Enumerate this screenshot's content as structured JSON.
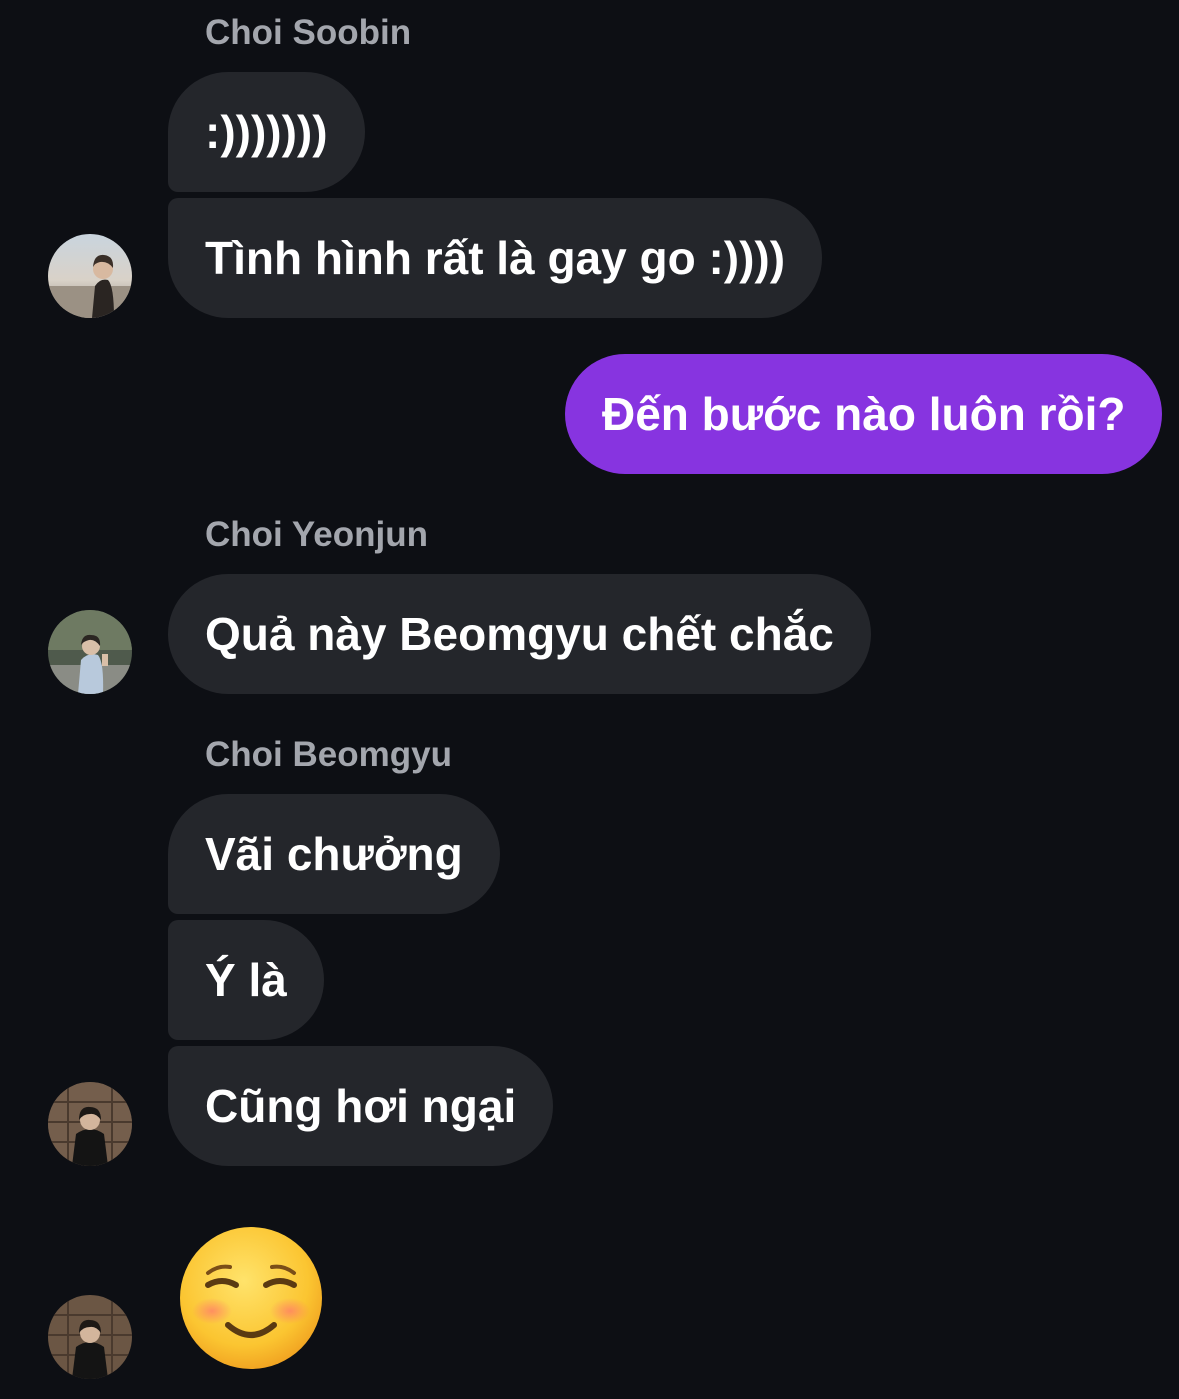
{
  "conversation": {
    "groups": [
      {
        "sender": "Choi Soobin",
        "avatar_icon": "avatar-soobin",
        "messages": [
          ":)))))))",
          "Tình hình rất là gay go :))))"
        ]
      },
      {
        "sender": "",
        "outgoing": true,
        "messages": [
          "Đến bước nào luôn rồi?"
        ]
      },
      {
        "sender": "Choi Yeonjun",
        "avatar_icon": "avatar-yeonjun",
        "messages": [
          "Quả này Beomgyu chết chắc"
        ]
      },
      {
        "sender": "Choi Beomgyu",
        "avatar_icon": "avatar-beomgyu",
        "messages": [
          "Vãi chưởng",
          "Ý là",
          "Cũng hơi ngại"
        ]
      },
      {
        "sender": "",
        "avatar_icon": "avatar-beomgyu",
        "messages": [],
        "emoji_icon": "smiling-face-emoji-icon"
      }
    ]
  },
  "colors": {
    "background": "#0d0f14",
    "incoming_bubble": "#24262b",
    "outgoing_bubble": "#8734e0",
    "sender_name": "#a3a6ad",
    "message_text": "#ffffff"
  }
}
